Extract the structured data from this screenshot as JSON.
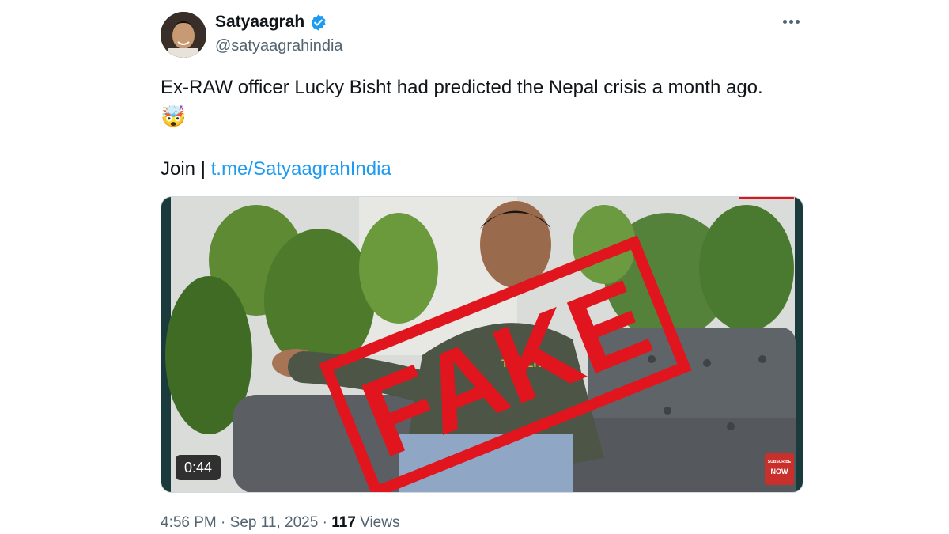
{
  "author": {
    "display_name": "Satyaagrah",
    "handle": "@satyaagrahindia",
    "verified_icon": "verified-badge-icon",
    "avatar_icon": "profile-avatar"
  },
  "more_menu_icon": "more-dots-icon",
  "tweet": {
    "text": "Ex-RAW officer Lucky Bisht had predicted the Nepal crisis a month ago.",
    "emoji": "🤯",
    "join_prefix": "Join | ",
    "link_text": "t.me/SatyaagrahIndia"
  },
  "media": {
    "overlay_stamp": "FAKE",
    "duration": "0:44",
    "subscribe_badge_top": "SUBSCRIBE",
    "subscribe_badge_bottom": "NOW"
  },
  "meta": {
    "time": "4:56 PM",
    "separator1": " · ",
    "date": "Sep 11, 2025",
    "separator2": " · ",
    "views_count": "117",
    "views_label": " Views"
  },
  "colors": {
    "link": "#1d9bf0",
    "verified": "#1d9bf0",
    "stamp": "#e0151d",
    "secondary_text": "#536471"
  }
}
